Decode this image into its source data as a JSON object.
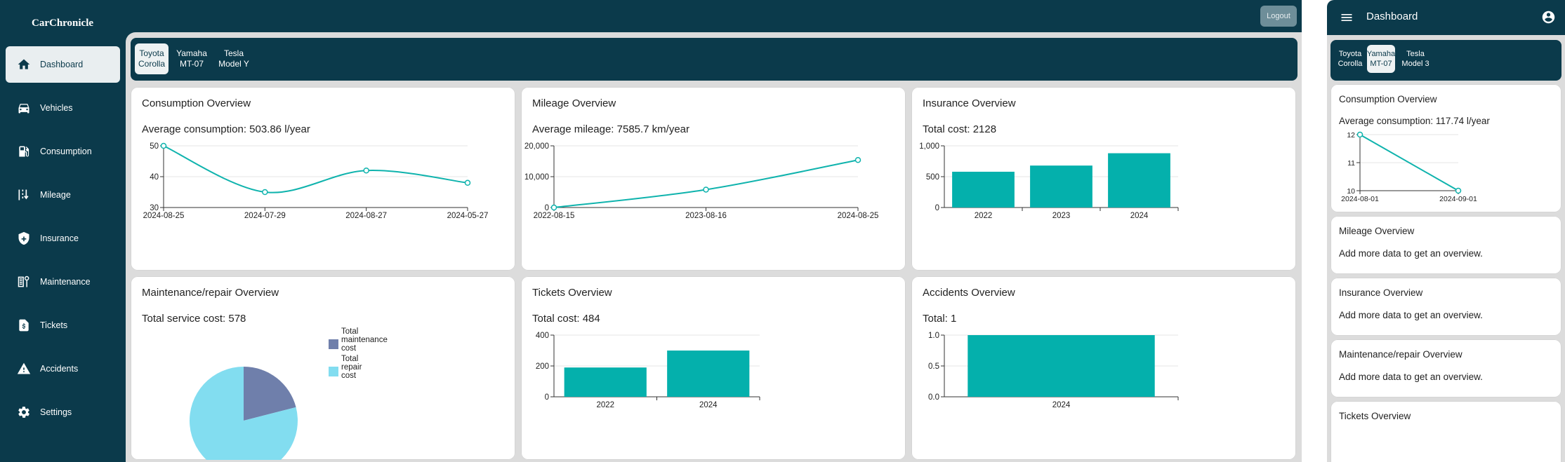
{
  "app": {
    "brand": "CarChronicle",
    "logout_label": "Logout"
  },
  "sidebar": {
    "items": [
      {
        "label": "Dashboard",
        "icon": "home-icon"
      },
      {
        "label": "Vehicles",
        "icon": "car-icon"
      },
      {
        "label": "Consumption",
        "icon": "fuel-icon"
      },
      {
        "label": "Mileage",
        "icon": "mileage-icon"
      },
      {
        "label": "Insurance",
        "icon": "shield-icon"
      },
      {
        "label": "Maintenance",
        "icon": "maintenance-icon"
      },
      {
        "label": "Tickets",
        "icon": "ticket-icon"
      },
      {
        "label": "Accidents",
        "icon": "warning-icon"
      },
      {
        "label": "Settings",
        "icon": "gear-icon"
      }
    ]
  },
  "vehicle_tabs": [
    {
      "line1": "Toyota",
      "line2": "Corolla"
    },
    {
      "line1": "Yamaha",
      "line2": "MT-07"
    },
    {
      "line1": "Tesla",
      "line2": "Model Y"
    }
  ],
  "cards": {
    "consumption": {
      "title": "Consumption Overview",
      "stat": "Average consumption: 503.86 l/year"
    },
    "mileage": {
      "title": "Mileage Overview",
      "stat": "Average mileage: 7585.7 km/year"
    },
    "insurance": {
      "title": "Insurance Overview",
      "stat": "Total cost: 2128"
    },
    "maintenance": {
      "title": "Maintenance/repair Overview",
      "stat": "Total service cost: 578"
    },
    "tickets": {
      "title": "Tickets Overview",
      "stat": "Total cost: 484"
    },
    "accidents": {
      "title": "Accidents Overview",
      "stat": "Total: 1"
    }
  },
  "chart_data": [
    {
      "id": "consumption",
      "type": "line",
      "x": [
        "2024-08-25",
        "2024-07-29",
        "2024-08-27",
        "2024-05-27"
      ],
      "values": [
        50,
        35,
        42,
        38
      ],
      "yticks": [
        "30",
        "40",
        "50"
      ],
      "ylim": [
        30,
        50
      ],
      "grid": true,
      "color": "#0fb3ad"
    },
    {
      "id": "mileage",
      "type": "line",
      "x": [
        "2022-08-15",
        "2023-08-16",
        "2024-08-25"
      ],
      "values": [
        0,
        5800,
        15400
      ],
      "yticks": [
        "0",
        "10,000",
        "20,000"
      ],
      "ylim": [
        0,
        20000
      ],
      "grid": true,
      "color": "#0fb3ad"
    },
    {
      "id": "insurance",
      "type": "bar",
      "categories": [
        "2022",
        "2023",
        "2024"
      ],
      "values": [
        580,
        680,
        880
      ],
      "yticks": [
        "0",
        "500",
        "1,000"
      ],
      "ylim": [
        0,
        1000
      ],
      "grid": true,
      "color": "#04b0ac"
    },
    {
      "id": "maintenance",
      "type": "pie",
      "series": [
        {
          "name": "Total maintenance cost",
          "label_lines": [
            "Total",
            "maintenance",
            "cost"
          ],
          "fraction": 0.21,
          "color": "#6f7fab"
        },
        {
          "name": "Total repair cost",
          "label_lines": [
            "Total",
            "repair",
            "cost"
          ],
          "fraction": 0.79,
          "color": "#82ddf0"
        }
      ],
      "legend": "right"
    },
    {
      "id": "tickets",
      "type": "bar",
      "categories": [
        "2022",
        "2024"
      ],
      "values": [
        190,
        300
      ],
      "yticks": [
        "0",
        "200",
        "400"
      ],
      "ylim": [
        0,
        400
      ],
      "grid": true,
      "color": "#04b0ac"
    },
    {
      "id": "accidents",
      "type": "bar",
      "categories": [
        "2024"
      ],
      "values": [
        1.0
      ],
      "yticks": [
        "0.0",
        "0.5",
        "1.0"
      ],
      "ylim": [
        0,
        1
      ],
      "grid": true,
      "color": "#04b0ac"
    },
    {
      "id": "m-consumption",
      "type": "line",
      "x": [
        "2024-08-01",
        "2024-09-01"
      ],
      "values": [
        12,
        10
      ],
      "yticks": [
        "10",
        "11",
        "12"
      ],
      "ylim": [
        10,
        12
      ],
      "grid": true,
      "color": "#0fb3ad"
    }
  ],
  "mobile": {
    "header_title": "Dashboard",
    "tabs": [
      {
        "line1": "Toyota",
        "line2": "Corolla"
      },
      {
        "line1": "Yamaha",
        "line2": "MT-07"
      },
      {
        "line1": "Tesla",
        "line2": "Model 3"
      }
    ],
    "cards": {
      "consumption": {
        "title": "Consumption Overview",
        "stat": "Average consumption: 117.74 l/year"
      },
      "mileage": {
        "title": "Mileage Overview",
        "message": "Add more data to get an overview."
      },
      "insurance": {
        "title": "Insurance Overview",
        "message": "Add more data to get an overview."
      },
      "maintenance": {
        "title": "Maintenance/repair Overview",
        "message": "Add more data to get an overview."
      },
      "tickets": {
        "title": "Tickets Overview"
      }
    }
  }
}
